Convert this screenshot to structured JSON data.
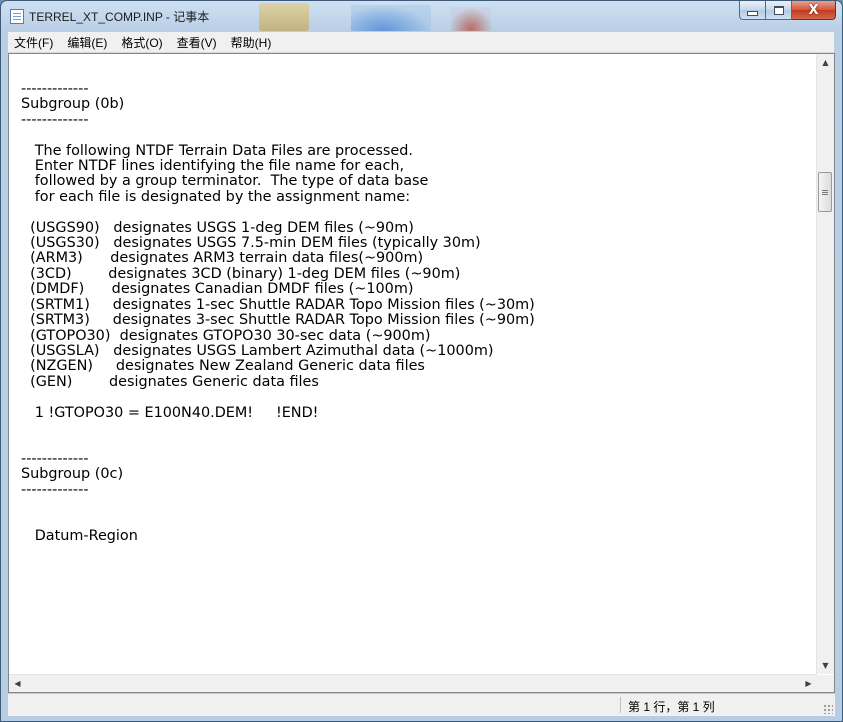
{
  "window": {
    "title": "TERREL_XT_COMP.INP - 记事本"
  },
  "caption_buttons": {
    "close_symbol": "X"
  },
  "menu": [
    {
      "label": "文件(F)"
    },
    {
      "label": "编辑(E)"
    },
    {
      "label": "格式(O)"
    },
    {
      "label": "查看(V)"
    },
    {
      "label": "帮助(H)"
    }
  ],
  "document": {
    "content": "-------------\nSubgroup (0b)\n-------------\n\n   The following NTDF Terrain Data Files are processed.\n   Enter NTDF lines identifying the file name for each,\n   followed by a group terminator.  The type of data base\n   for each file is designated by the assignment name:\n\n  (USGS90)   designates USGS 1-deg DEM files (~90m)\n  (USGS30)   designates USGS 7.5-min DEM files (typically 30m)\n  (ARM3)      designates ARM3 terrain data files(~900m)\n  (3CD)        designates 3CD (binary) 1-deg DEM files (~90m)\n  (DMDF)      designates Canadian DMDF files (~100m)\n  (SRTM1)     designates 1-sec Shuttle RADAR Topo Mission files (~30m)\n  (SRTM3)     designates 3-sec Shuttle RADAR Topo Mission files (~90m)\n  (GTOPO30)  designates GTOPO30 30-sec data (~900m)\n  (USGSLA)   designates USGS Lambert Azimuthal data (~1000m)\n  (NZGEN)     designates New Zealand Generic data files\n  (GEN)        designates Generic data files\n\n   1 !GTOPO30 = E100N40.DEM!     !END!\n\n\n-------------\nSubgroup (0c)\n-------------\n\n\n   Datum-Region"
  },
  "scrollbar": {
    "up_arrow": "▲",
    "down_arrow": "▼",
    "left_arrow": "◀",
    "right_arrow": "▶"
  },
  "status": {
    "position": "第 1 行，第 1 列"
  },
  "colors": {
    "title_bar": "#b9cfe6",
    "close_button": "#c03a1f",
    "menu_bar": "#f0f0f0",
    "editor_background": "#ffffff"
  }
}
